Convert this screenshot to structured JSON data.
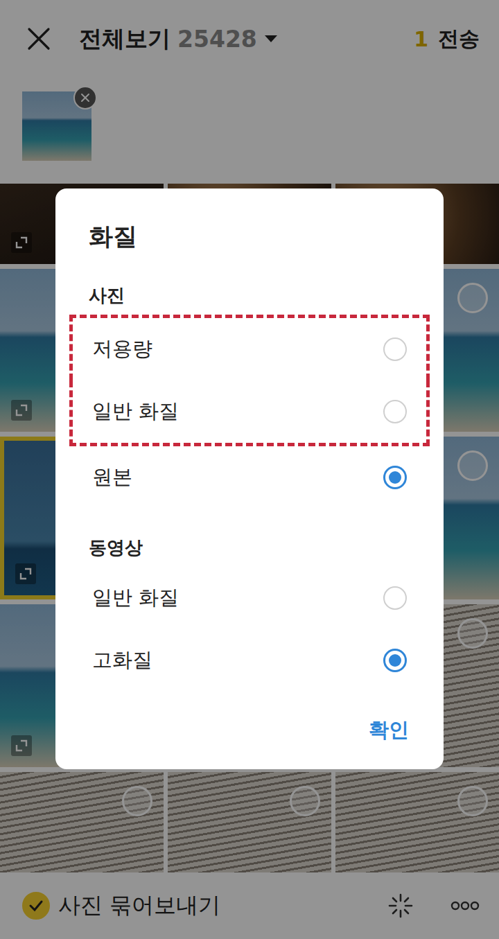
{
  "header": {
    "title": "전체보기",
    "count": "25428",
    "selected_count": "1",
    "send": "전송"
  },
  "selected_photos": [
    {
      "kind": "sea"
    }
  ],
  "grid": [
    {
      "kind": "dark",
      "badge": "expand",
      "selected": false
    },
    {
      "kind": "food",
      "badge": "none",
      "selected": false
    },
    {
      "kind": "food",
      "badge": "none",
      "selected": false
    },
    {
      "kind": "sea",
      "badge": "expand",
      "selected": false
    },
    {
      "kind": "sea",
      "badge": "none",
      "selected": false
    },
    {
      "kind": "sea",
      "badge": "circle",
      "selected": false
    },
    {
      "kind": "deep",
      "badge": "expand",
      "selected": true
    },
    {
      "kind": "sea",
      "badge": "none",
      "selected": false
    },
    {
      "kind": "sea",
      "badge": "circle",
      "selected": false
    },
    {
      "kind": "sea",
      "badge": "expand",
      "selected": false
    },
    {
      "kind": "fabric",
      "badge": "none",
      "selected": false
    },
    {
      "kind": "fabric",
      "badge": "circle",
      "selected": false
    },
    {
      "kind": "fabric",
      "badge": "circle",
      "selected": false
    },
    {
      "kind": "fabric",
      "badge": "circle",
      "selected": false
    },
    {
      "kind": "fabric",
      "badge": "circle",
      "selected": false
    }
  ],
  "dialog": {
    "title": "화질",
    "sections": [
      {
        "title": "사진",
        "options": [
          {
            "label": "저용량",
            "selected": false,
            "highlighted": true
          },
          {
            "label": "일반 화질",
            "selected": false,
            "highlighted": true
          },
          {
            "label": "원본",
            "selected": true,
            "highlighted": false
          }
        ]
      },
      {
        "title": "동영상",
        "options": [
          {
            "label": "일반 화질",
            "selected": false,
            "highlighted": false
          },
          {
            "label": "고화질",
            "selected": true,
            "highlighted": false
          }
        ]
      }
    ],
    "confirm": "확인"
  },
  "bottom_bar": {
    "bundle_label": "사진 묶어보내기",
    "bundle_checked": true
  }
}
